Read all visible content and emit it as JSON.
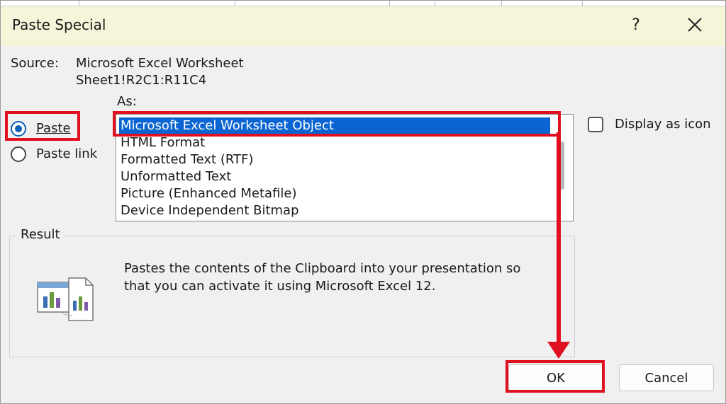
{
  "window": {
    "title": "Paste Special",
    "help_label": "?",
    "close_icon": "close-icon"
  },
  "source": {
    "label": "Source:",
    "value_line1": "Microsoft Excel Worksheet",
    "value_line2": "Sheet1!R2C1:R11C4"
  },
  "as_label": "As:",
  "options": {
    "paste_label": "Paste",
    "paste_link_label": "Paste link",
    "selected": "Paste"
  },
  "format_list": {
    "items": [
      "Microsoft Excel Worksheet Object",
      "HTML Format",
      "Formatted Text (RTF)",
      "Unformatted Text",
      "Picture (Enhanced Metafile)",
      "Device Independent Bitmap"
    ],
    "selected_index": 0
  },
  "display_as_icon": {
    "label": "Display as icon",
    "checked": false
  },
  "result": {
    "label": "Result",
    "line1": "Pastes the contents of the Clipboard into your presentation so",
    "line2": "that you can activate it using Microsoft Excel 12.",
    "icon": "excel-object-paste-icon"
  },
  "buttons": {
    "ok": "OK",
    "cancel": "Cancel"
  },
  "colors": {
    "annotation": "#e01020",
    "selection": "#0a64d2",
    "title_bar": "#f6f5d9"
  }
}
